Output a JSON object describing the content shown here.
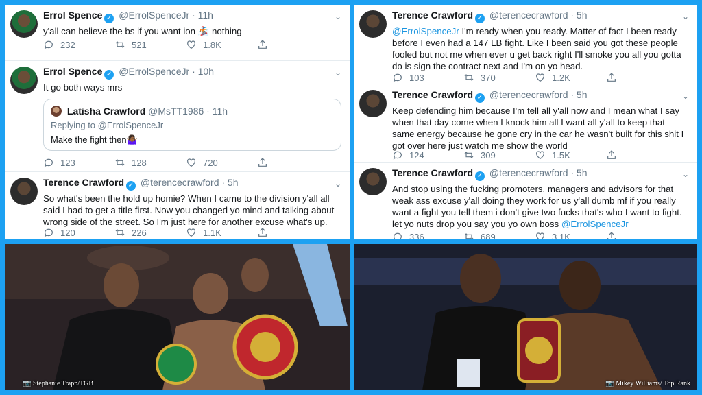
{
  "left_panel": {
    "tweet1": {
      "name": "Errol Spence",
      "handle": "@ErrolSpenceJr",
      "time": "· 11h",
      "text": "y'all can believe the bs if you want ion 🏂 nothing",
      "replies": "232",
      "retweets": "521",
      "likes": "1.8K"
    },
    "tweet2": {
      "name": "Errol Spence",
      "handle": "@ErrolSpenceJr",
      "time": "· 10h",
      "text": "It go both ways mrs",
      "quote": {
        "name": "Latisha Crawford",
        "handle": "@MsTT1986",
        "time": "· 11h",
        "replying": "Replying to @ErrolSpenceJr",
        "text": "Make the fight then🤷🏾‍♀️"
      },
      "replies": "123",
      "retweets": "128",
      "likes": "720"
    },
    "tweet3": {
      "name": "Terence Crawford",
      "handle": "@terencecrawford",
      "time": "· 5h",
      "text": "So what's been the hold up homie? When I came to the division y'all all said I had to get a title first. Now you changed yo mind and talking about wrong side of the street. So I'm just here for another excuse what's up.",
      "replies": "120",
      "retweets": "226",
      "likes": "1.1K"
    }
  },
  "right_panel": {
    "tweet1": {
      "name": "Terence Crawford",
      "handle": "@terencecrawford",
      "time": "· 5h",
      "mention": "@ErrolSpenceJr",
      "text": " I'm ready when you ready. Matter of fact I been ready before I even had a 147 LB fight. Like I been said you got these people fooled but not me when ever u get back right I'll smoke you all you gotta do is sign the contract next and I'm on yo head.",
      "replies": "103",
      "retweets": "370",
      "likes": "1.2K"
    },
    "tweet2": {
      "name": "Terence Crawford",
      "handle": "@terencecrawford",
      "time": "· 5h",
      "text": "Keep defending him because I'm tell all y'all now and I mean what I say when that day come when I knock him all I want all y'all to keep that same energy because he gone cry in the car he wasn't built for this shit I got over here just watch me show the world",
      "replies": "124",
      "retweets": "309",
      "likes": "1.5K"
    },
    "tweet3": {
      "name": "Terence Crawford",
      "handle": "@terencecrawford",
      "time": "· 5h",
      "text": "And stop using the fucking promoters, managers and advisors for that weak ass excuse y'all doing they work for us y'all dumb mf if you really want a fight you tell them i don't give two fucks that's who I want to fight. let yo nuts drop you say you yo own boss ",
      "mention": "@ErrolSpenceJr",
      "replies": "336",
      "retweets": "689",
      "likes": "3.1K"
    }
  },
  "photos": {
    "left_credit": "Stephanie Trapp/TGB",
    "right_credit": "Mikey Williams/ Top Rank"
  },
  "colors": {
    "twitter_blue": "#1da1f2",
    "mention": "#1b95e0"
  },
  "icons": [
    "verified-icon",
    "reply-icon",
    "retweet-icon",
    "like-icon",
    "share-icon",
    "caret-icon",
    "camera-icon"
  ]
}
